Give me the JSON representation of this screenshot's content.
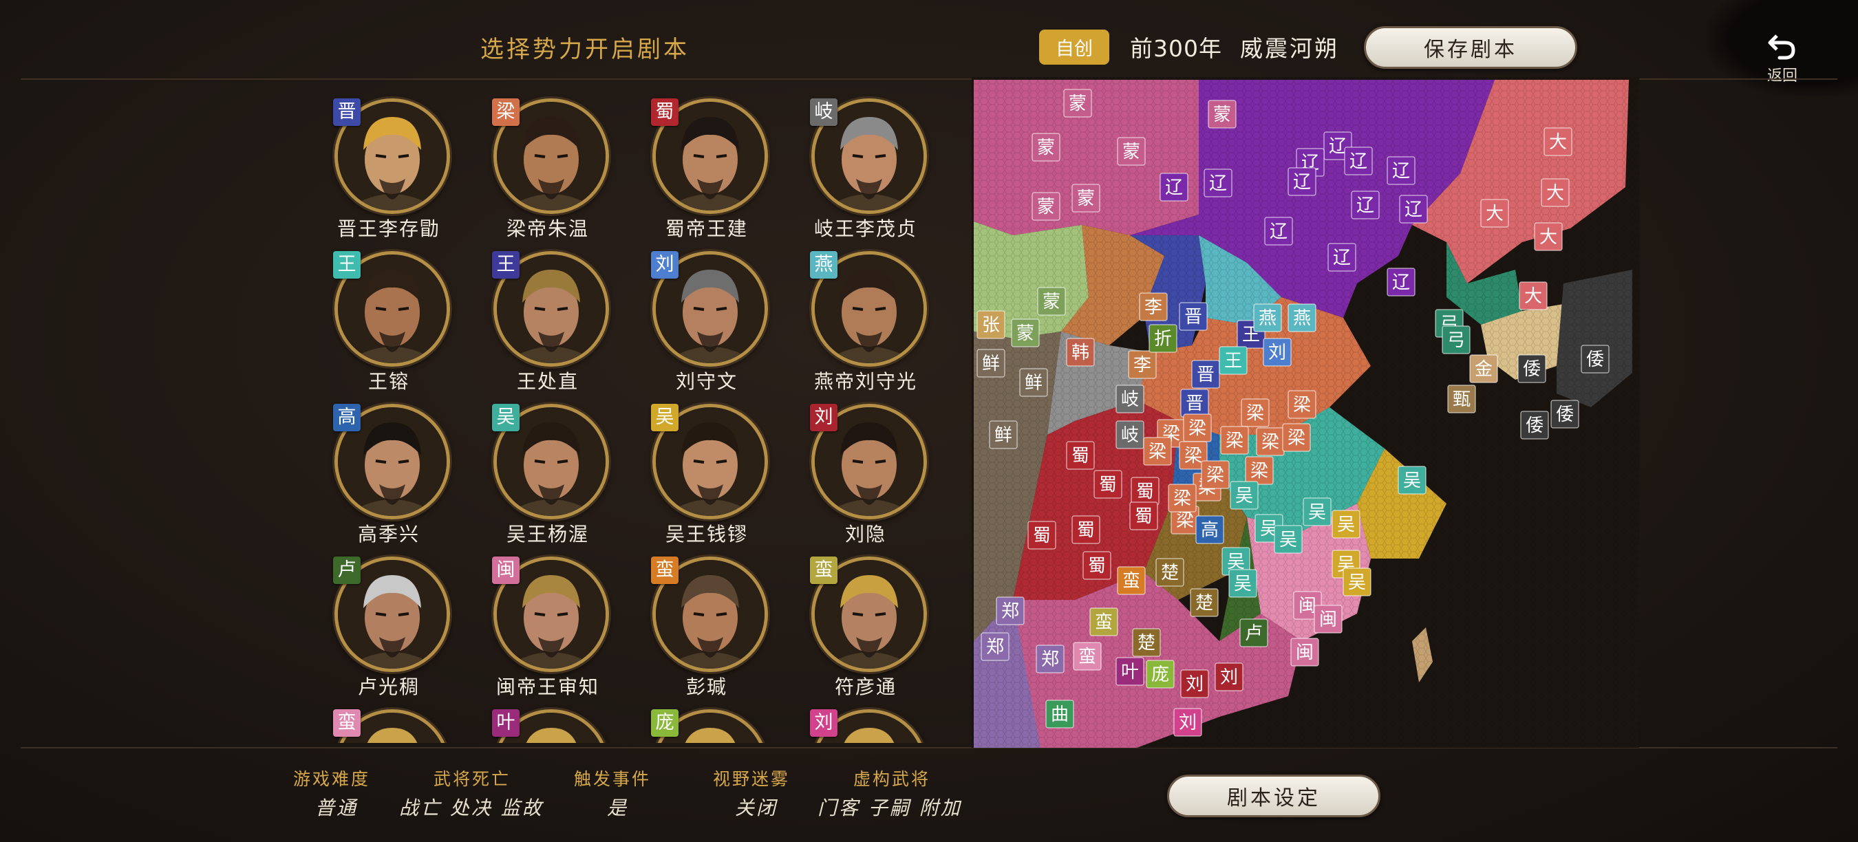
{
  "header": {
    "title": "选择势力开启剧本",
    "mode_badge": "自创",
    "year": "前300年",
    "scenario_name": "威震河朔",
    "save_button": "保存剧本",
    "back_label": "返回"
  },
  "factions": [
    {
      "tag": "晋",
      "tag_color": "#3d4aa8",
      "name": "晋王李存勖",
      "skin": "#c99a6b",
      "hair": "#d9a63a"
    },
    {
      "tag": "梁",
      "tag_color": "#d2704a",
      "name": "梁帝朱温",
      "skin": "#b07a52",
      "hair": "#2a1d16"
    },
    {
      "tag": "蜀",
      "tag_color": "#b2272e",
      "name": "蜀帝王建",
      "skin": "#b98460",
      "hair": "#1e1612"
    },
    {
      "tag": "岐",
      "tag_color": "#6b6b6b",
      "name": "岐王李茂贞",
      "skin": "#c08a66",
      "hair": "#8a8a8a"
    },
    {
      "tag": "王",
      "tag_color": "#3fbcae",
      "name": "王镕",
      "skin": "#a97350",
      "hair": "#2d2014"
    },
    {
      "tag": "王",
      "tag_color": "#3e3a9a",
      "name": "王处直",
      "skin": "#b58361",
      "hair": "#9a7a3a"
    },
    {
      "tag": "刘",
      "tag_color": "#4e7fcf",
      "name": "刘守文",
      "skin": "#b48060",
      "hair": "#6e6e6e"
    },
    {
      "tag": "燕",
      "tag_color": "#5ab7c2",
      "name": "燕帝刘守光",
      "skin": "#b07c58",
      "hair": "#2a1e16"
    },
    {
      "tag": "高",
      "tag_color": "#2e64ad",
      "name": "高季兴",
      "skin": "#bd8a68",
      "hair": "#1a1410"
    },
    {
      "tag": "吴",
      "tag_color": "#3fae9c",
      "name": "吴王杨渥",
      "skin": "#b88462",
      "hair": "#241a12"
    },
    {
      "tag": "吴",
      "tag_color": "#d1a82a",
      "name": "吴王钱镠",
      "skin": "#c08c68",
      "hair": "#231911"
    },
    {
      "tag": "刘",
      "tag_color": "#a8242f",
      "name": "刘隐",
      "skin": "#b7835f",
      "hair": "#1f1611"
    },
    {
      "tag": "卢",
      "tag_color": "#3d6a2a",
      "name": "卢光稠",
      "skin": "#b28060",
      "hair": "#c8c8c8"
    },
    {
      "tag": "闽",
      "tag_color": "#d26f9b",
      "name": "闽帝王审知",
      "skin": "#b9866a",
      "hair": "#a88640"
    },
    {
      "tag": "蛮",
      "tag_color": "#d67c24",
      "name": "彭瑊",
      "skin": "#b27c58",
      "hair": "#5a4632"
    },
    {
      "tag": "蛮",
      "tag_color": "#b3a63e",
      "name": "符彦通",
      "skin": "#b48262",
      "hair": "#c8a040"
    },
    {
      "tag": "蛮",
      "tag_color": "#e089b0",
      "name": "",
      "skin": "#b07c58",
      "hair": "#c9a24a"
    },
    {
      "tag": "叶",
      "tag_color": "#9a2b7a",
      "name": "",
      "skin": "#b07c58",
      "hair": "#c9a24a"
    },
    {
      "tag": "庞",
      "tag_color": "#8ab83a",
      "name": "",
      "skin": "#b07c58",
      "hair": "#c9a24a"
    },
    {
      "tag": "刘",
      "tag_color": "#d2418c",
      "name": "",
      "skin": "#b07c58",
      "hair": "#c9a24a"
    }
  ],
  "map_labels": [
    {
      "t": "蒙",
      "c": "#c45c8c"
    },
    {
      "t": "蒙",
      "c": "#c45c8c"
    },
    {
      "t": "蒙",
      "c": "#c45c8c"
    },
    {
      "t": "蒙",
      "c": "#c45c8c"
    },
    {
      "t": "蒙",
      "c": "#c45c8c"
    },
    {
      "t": "蒙",
      "c": "#c45c8c"
    },
    {
      "t": "蒙",
      "c": "#7da05a"
    },
    {
      "t": "蒙",
      "c": "#7da05a"
    },
    {
      "t": "辽",
      "c": "#7a2aa8"
    },
    {
      "t": "辽",
      "c": "#7a2aa8"
    },
    {
      "t": "辽",
      "c": "#7a2aa8"
    },
    {
      "t": "辽",
      "c": "#7a2aa8"
    },
    {
      "t": "辽",
      "c": "#7a2aa8"
    },
    {
      "t": "辽",
      "c": "#7a2aa8"
    },
    {
      "t": "辽",
      "c": "#7a2aa8"
    },
    {
      "t": "辽",
      "c": "#7a2aa8"
    },
    {
      "t": "辽",
      "c": "#7a2aa8"
    },
    {
      "t": "辽",
      "c": "#7a2aa8"
    },
    {
      "t": "辽",
      "c": "#7a2aa8"
    },
    {
      "t": "辽",
      "c": "#7a2aa8"
    },
    {
      "t": "大",
      "c": "#d9666a"
    },
    {
      "t": "大",
      "c": "#d9666a"
    },
    {
      "t": "大",
      "c": "#d9666a"
    },
    {
      "t": "大",
      "c": "#d9666a"
    },
    {
      "t": "大",
      "c": "#d9666a"
    },
    {
      "t": "张",
      "c": "#c8a058"
    },
    {
      "t": "鲜",
      "c": "#7a6a58"
    },
    {
      "t": "鲜",
      "c": "#7a6a58"
    },
    {
      "t": "鲜",
      "c": "#7a6a58"
    },
    {
      "t": "韩",
      "c": "#c0604a"
    },
    {
      "t": "李",
      "c": "#c47a44"
    },
    {
      "t": "李",
      "c": "#c47a44"
    },
    {
      "t": "折",
      "c": "#5a8a2a"
    },
    {
      "t": "晋",
      "c": "#3d4aa8"
    },
    {
      "t": "晋",
      "c": "#3d4aa8"
    },
    {
      "t": "晋",
      "c": "#3d4aa8"
    },
    {
      "t": "王",
      "c": "#3e3a9a"
    },
    {
      "t": "燕",
      "c": "#5ab7c2"
    },
    {
      "t": "燕",
      "c": "#5ab7c2"
    },
    {
      "t": "王",
      "c": "#3fbcae"
    },
    {
      "t": "刘",
      "c": "#4e7fcf"
    },
    {
      "t": "岐",
      "c": "#6b6b6b"
    },
    {
      "t": "岐",
      "c": "#6b6b6b"
    },
    {
      "t": "梁",
      "c": "#d2704a"
    },
    {
      "t": "梁",
      "c": "#d2704a"
    },
    {
      "t": "梁",
      "c": "#d2704a"
    },
    {
      "t": "梁",
      "c": "#d2704a"
    },
    {
      "t": "梁",
      "c": "#d2704a"
    },
    {
      "t": "梁",
      "c": "#d2704a"
    },
    {
      "t": "梁",
      "c": "#d2704a"
    },
    {
      "t": "梁",
      "c": "#d2704a"
    },
    {
      "t": "梁",
      "c": "#d2704a"
    },
    {
      "t": "梁",
      "c": "#d2704a"
    },
    {
      "t": "梁",
      "c": "#d2704a"
    },
    {
      "t": "梁",
      "c": "#d2704a"
    },
    {
      "t": "梁",
      "c": "#d2704a"
    },
    {
      "t": "梁",
      "c": "#d2704a"
    },
    {
      "t": "蜀",
      "c": "#b2272e"
    },
    {
      "t": "蜀",
      "c": "#b2272e"
    },
    {
      "t": "蜀",
      "c": "#b2272e"
    },
    {
      "t": "蜀",
      "c": "#b2272e"
    },
    {
      "t": "蜀",
      "c": "#b2272e"
    },
    {
      "t": "蜀",
      "c": "#b2272e"
    },
    {
      "t": "蜀",
      "c": "#b2272e"
    },
    {
      "t": "高",
      "c": "#2e64ad"
    },
    {
      "t": "吴",
      "c": "#3fae9c"
    },
    {
      "t": "吴",
      "c": "#3fae9c"
    },
    {
      "t": "吴",
      "c": "#3fae9c"
    },
    {
      "t": "吴",
      "c": "#3fae9c"
    },
    {
      "t": "吴",
      "c": "#3fae9c"
    },
    {
      "t": "吴",
      "c": "#3fae9c"
    },
    {
      "t": "吴",
      "c": "#3fae9c"
    },
    {
      "t": "吴",
      "c": "#d1a82a"
    },
    {
      "t": "吴",
      "c": "#d1a82a"
    },
    {
      "t": "吴",
      "c": "#d1a82a"
    },
    {
      "t": "弓",
      "c": "#2d8a6a"
    },
    {
      "t": "弓",
      "c": "#2d8a6a"
    },
    {
      "t": "金",
      "c": "#c8a070"
    },
    {
      "t": "甄",
      "c": "#9a7a4a"
    },
    {
      "t": "倭",
      "c": "#3a3a3a"
    },
    {
      "t": "倭",
      "c": "#3a3a3a"
    },
    {
      "t": "倭",
      "c": "#3a3a3a"
    },
    {
      "t": "倭",
      "c": "#3a3a3a"
    },
    {
      "t": "蛮",
      "c": "#d67c24"
    },
    {
      "t": "蛮",
      "c": "#b3a63e"
    },
    {
      "t": "蛮",
      "c": "#e089b0"
    },
    {
      "t": "楚",
      "c": "#8a6a2a"
    },
    {
      "t": "楚",
      "c": "#8a6a2a"
    },
    {
      "t": "楚",
      "c": "#8a6a2a"
    },
    {
      "t": "闽",
      "c": "#d26f9b"
    },
    {
      "t": "闽",
      "c": "#d26f9b"
    },
    {
      "t": "闽",
      "c": "#d26f9b"
    },
    {
      "t": "卢",
      "c": "#3d6a2a"
    },
    {
      "t": "郑",
      "c": "#8a6aaa"
    },
    {
      "t": "郑",
      "c": "#8a6aaa"
    },
    {
      "t": "郑",
      "c": "#8a6aaa"
    },
    {
      "t": "叶",
      "c": "#9a2b7a"
    },
    {
      "t": "庞",
      "c": "#8ab83a"
    },
    {
      "t": "刘",
      "c": "#a8242f"
    },
    {
      "t": "刘",
      "c": "#a8242f"
    },
    {
      "t": "刘",
      "c": "#d2418c"
    },
    {
      "t": "曲",
      "c": "#3a9a5a"
    }
  ],
  "settings": [
    {
      "label": "游戏难度",
      "value": "普通"
    },
    {
      "label": "武将死亡",
      "value": "战亡 处决 监故"
    },
    {
      "label": "触发事件",
      "value": "是"
    },
    {
      "label": "视野迷雾",
      "value": "关闭"
    },
    {
      "label": "虚构武将",
      "value": "门客 子嗣 附加"
    }
  ],
  "scenario_settings_button": "剧本设定",
  "colors": {
    "accent": "#d6a84a",
    "badge": "#d3a332",
    "bg": "#1d1612"
  }
}
